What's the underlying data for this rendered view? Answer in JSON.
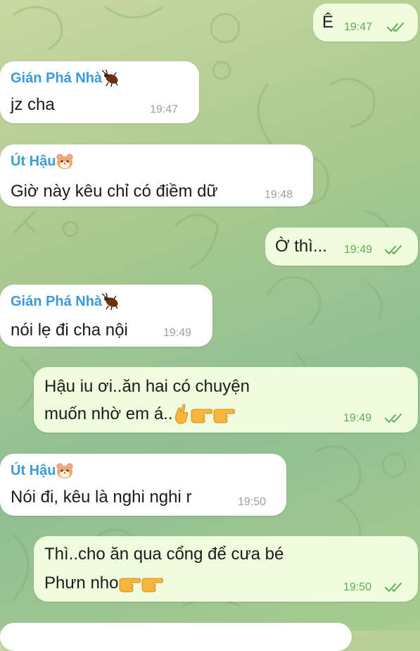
{
  "colors": {
    "incoming_bubble": "#ffffff",
    "outgoing_bubble": "#effdde",
    "sender_name": "#3b9ad9",
    "outgoing_time": "#5fae54",
    "incoming_time": "#a0a0a0"
  },
  "messages": [
    {
      "direction": "outgoing",
      "text": "Ê",
      "time": "19:47",
      "status": "read-double-check"
    },
    {
      "direction": "incoming",
      "sender": "Gián Phá Nhà",
      "sender_icon": "cockroach-emoji",
      "text": "jz cha",
      "time": "19:47"
    },
    {
      "direction": "incoming",
      "sender": "Út Hậu",
      "sender_icon": "hamster-emoji",
      "text": "Giờ này kêu chỉ có điềm dữ",
      "time": "19:48"
    },
    {
      "direction": "outgoing",
      "text": "Ờ thì...",
      "time": "19:49",
      "status": "read-double-check"
    },
    {
      "direction": "incoming",
      "sender": "Gián Phá Nhà",
      "sender_icon": "cockroach-emoji",
      "text": "nói lẹ đi cha nội",
      "time": "19:49"
    },
    {
      "direction": "outgoing",
      "text_line1": "Hậu iu ơi..ăn hai có chuyện",
      "text_line2": "muốn nhờ em á..",
      "emojis": [
        "crossed-fingers-emoji",
        "pointing-right-emoji",
        "pointing-right-emoji"
      ],
      "time": "19:49",
      "status": "read-double-check"
    },
    {
      "direction": "incoming",
      "sender": "Út Hậu",
      "sender_icon": "hamster-emoji",
      "text": "Nói đi, kêu là nghi nghi r",
      "time": "19:50"
    },
    {
      "direction": "outgoing",
      "text_line1": "Thì..cho ăn qua cổng để cưa bé",
      "text_line2": "Phưn nho",
      "emojis": [
        "pointing-right-emoji",
        "pointing-right-emoji"
      ],
      "time": "19:50",
      "status": "read-double-check"
    }
  ]
}
